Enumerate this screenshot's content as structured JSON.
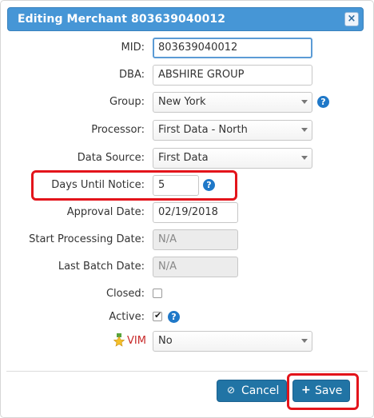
{
  "dialog": {
    "title": "Editing Merchant 803639040012",
    "close_icon": "×"
  },
  "fields": {
    "mid": {
      "label": "MID:",
      "value": "803639040012"
    },
    "dba": {
      "label": "DBA:",
      "value": "ABSHIRE GROUP"
    },
    "group": {
      "label": "Group:",
      "value": "New York"
    },
    "processor": {
      "label": "Processor:",
      "value": "First Data - North"
    },
    "data_source": {
      "label": "Data Source:",
      "value": "First Data"
    },
    "days_until_notice": {
      "label": "Days Until Notice:",
      "value": "5"
    },
    "approval_date": {
      "label": "Approval Date:",
      "value": "02/19/2018"
    },
    "start_processing_date": {
      "label": "Start Processing Date:",
      "value": "N/A"
    },
    "last_batch_date": {
      "label": "Last Batch Date:",
      "value": "N/A"
    },
    "closed": {
      "label": "Closed:",
      "checked": false
    },
    "active": {
      "label": "Active:",
      "checked": true
    },
    "vim": {
      "label": "VIM",
      "value": "No",
      "icon": "award-icon"
    }
  },
  "help_icon": "?",
  "buttons": {
    "cancel_label": "Cancel",
    "cancel_icon": "⊘",
    "save_label": "Save",
    "save_icon": "+"
  },
  "colors": {
    "title_bar": "#4696d6",
    "button": "#2174a5",
    "highlight": "#e3141b",
    "help": "#1f78c8"
  }
}
